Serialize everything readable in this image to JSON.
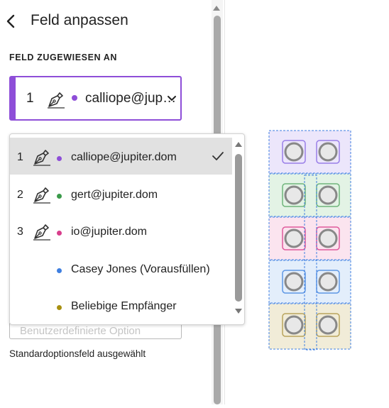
{
  "header": {
    "title": "Feld anpassen"
  },
  "section": {
    "label": "FELD ZUGEWIESEN AN"
  },
  "assigned": {
    "number": "1",
    "email": "calliope@jup…",
    "color": "#8e4ed8"
  },
  "dropdown": {
    "options": [
      {
        "number": "1",
        "email": "calliope@jupiter.dom",
        "color": "#8e4ed8",
        "selected": true
      },
      {
        "number": "2",
        "email": "gert@jupiter.dom",
        "color": "#3a9a4a"
      },
      {
        "number": "3",
        "email": "io@jupiter.dom",
        "color": "#d83e8c"
      },
      {
        "number": "",
        "email": "Casey Jones (Vorausfüllen)",
        "color": "#3f7fe0"
      },
      {
        "number": "",
        "email": "Beliebige Empfänger",
        "color": "#a89010"
      }
    ]
  },
  "option_field": {
    "placeholder": "Benutzerdefinierte Option"
  },
  "status": {
    "default_option": "Standardoptionsfeld ausgewählt"
  },
  "canvas": {
    "rows": [
      {
        "bg": "#ece6fb",
        "border": "#9a7fe8"
      },
      {
        "bg": "#e3f3e5",
        "border": "#6fb57b"
      },
      {
        "bg": "#fbe4ef",
        "border": "#e05a9c"
      },
      {
        "bg": "#e3eefb",
        "border": "#5e97e4"
      },
      {
        "bg": "#f1ecd8",
        "border": "#b9a45c"
      }
    ],
    "accent": "#3f7fe0"
  }
}
